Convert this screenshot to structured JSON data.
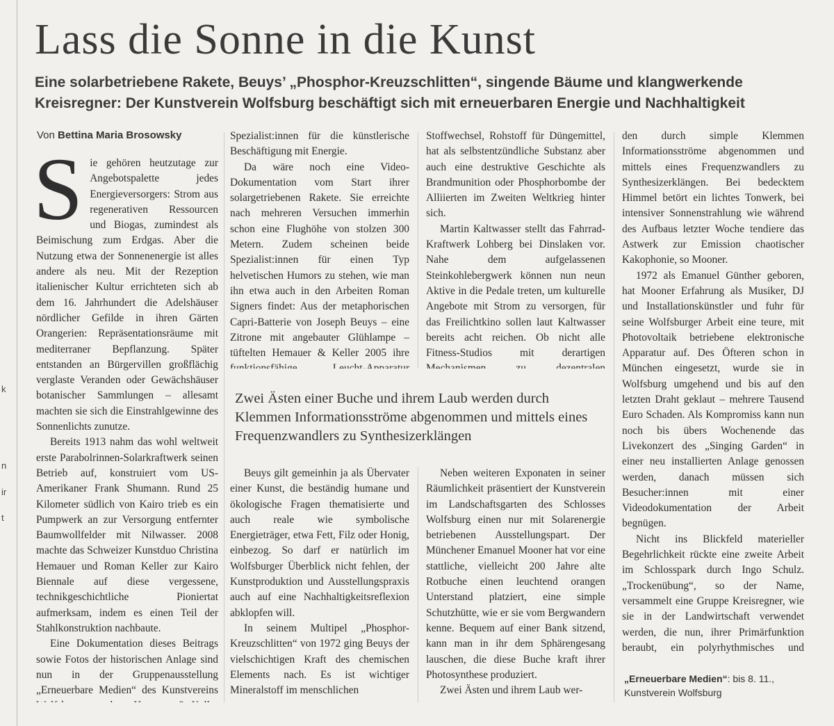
{
  "article": {
    "headline": "Lass die Sonne in die Kunst",
    "subheadline": "Eine solarbetriebene Rakete, Beuys’ „Phosphor-Kreuzschlitten“, singende Bäume und klangwerkende Kreisregner: Der Kunstverein Wolfsburg beschäftigt sich mit erneuerbaren Energie und Nachhaltigkeit",
    "byline_prefix": "Von",
    "byline_author": "Bettina Maria Brosowsky",
    "drop_cap": "S",
    "col1_lead": "ie gehören heutzutage zur Angebotspalette jedes Energieversorgers: Strom aus regenerativen Ressourcen und Biogas, zumindest als Beimischung zum Erdgas. Aber die Nutzung etwa der Sonnenenergie ist alles andere als neu. Mit der Rezeption italienischer Kultur errichteten sich ab dem 16. Jahrhundert die Adelshäuser nördlicher Gefilde in ihren Gärten Orangerien: Repräsentationsräume mit mediterraner Bepflanzung. Später entstanden an Bürgervillen großflächig verglaste Veranden oder Gewächshäuser botanischer Sammlungen – allesamt machten sie sich die Einstrahlgewinne des Sonnenlichts zunutze.",
    "col1_p2": "Bereits 1913 nahm das wohl weltweit erste Parabolrinnen-Solarkraftwerk seinen Betrieb auf, konstruiert vom US-Amerikaner Frank Shumann. Rund 25 Kilometer südlich von Kairo trieb es ein Pumpwerk an zur Versorgung entfernter Baumwollfelder mit Nilwasser. 2008 machte das Schweizer Kunstduo Christina Hemauer und Roman Keller zur Kairo Biennale auf diese vergessene, technikgeschichtliche Pioniertat aufmerksam, indem es einen Teil der Stahlkonstruktion nachbaute.",
    "col1_p3": "Eine Dokumentation dieses Beitrags sowie Fotos der historischen Anlage sind nun in der Gruppenausstellung „Erneuerbare Medien“ des Kunstvereins Wolfsburg zu sehen. Hemauer & Keller haben aber noch mehr im Gepäck, denn sie sind",
    "col2a_p1": "Spezialist:innen für die künstlerische Beschäftigung mit Energie.",
    "col2a_p2": "Da wäre noch eine Video-Dokumentation vom Start ihrer solargetriebenen Rakete. Sie erreichte nach mehreren Versuchen immerhin schon eine Flughöhe von stolzen 300 Metern. Zudem scheinen beide Spezialist:innen für einen Typ helvetischen Humors zu stehen, wie man ihn etwa auch in den Arbeiten Roman Signers findet: Aus der metaphorischen Capri-Batterie von Joseph Beuys – eine Zitrone mit angebauter Glühlampe – tüftelten Hemauer & Keller 2005 ihre funktionsfähige Leucht-Apparatur „Come On Beuys Shine“.",
    "col3a_p1": "Stoffwechsel, Rohstoff für Düngemittel, hat als selbstentzündliche Substanz aber auch eine destruktive Geschichte als Brandmunition oder Phosphorbombe der Alliierten im Zweiten Weltkrieg hinter sich.",
    "col3a_p2": "Martin Kaltwasser stellt das Fahrrad-Kraftwerk Lohberg bei Dinslaken vor. Nahe dem aufgelassenen Steinkohlebergwerk können nun neun Aktive in die Pedale treten, um kulturelle Angebote mit Strom zu versorgen, für das Freilichtkino sollen laut Kaltwasser bereits acht reichen. Ob nicht alle Fitness-Studios mit derartigen Mechanismen zu dezentralen Kleinkraftwerken werden könnten, gibt Kaltwasser noch zu denken.",
    "pull_quote": "Zwei Ästen einer Buche und ihrem Laub werden durch Klemmen Informationsströme abgenommen und mittels eines Frequenzwandlers zu Synthesizerklängen",
    "col2b_p1": "Beuys gilt gemeinhin ja als Übervater einer Kunst, die beständig humane und ökologische Fragen thematisierte und auch reale wie symbolische Energieträger, etwa Fett, Filz oder Honig, einbezog. So darf er natürlich im Wolfsburger Überblick nicht fehlen, der Kunstproduktion und Ausstellungspraxis auch auf eine Nachhaltigkeitsreflexion abklopfen will.",
    "col2b_p2": "In seinem Multipel „Phosphor-Kreuzschlitten“ von 1972 ging Beuys der vielschichtigen Kraft des chemischen Elements nach. Es ist wichtiger Mineralstoff im menschlichen",
    "col3b_p1": "Neben weiteren Exponaten in seiner Räumlichkeit präsentiert der Kunstverein im Landschaftsgarten des Schlosses Wolfsburg einen nur mit Solarenergie betriebenen Ausstellungspart. Der Münchener Emanuel Mooner hat vor eine stattliche, vielleicht 200 Jahre alte Rotbuche einen leuchtend orangen Unterstand platziert, eine simple Schutzhütte, wie er sie vom Bergwandern kenne. Bequem auf einer Bank sitzend, kann man in ihr dem Sphärengesang lauschen, die diese Buche kraft ihrer Photosynthese produziert.",
    "col3b_p2": "Zwei Ästen und ihrem Laub wer-",
    "col4_p1": "den durch simple Klemmen Informationsströme abgenommen und mittels eines Frequenzwandlers zu Synthesizerklängen. Bei bedecktem Himmel betört ein lichtes Tonwerk, bei intensiver Sonnenstrahlung wie während des Aufbaus letzter Woche tendiere das Astwerk zur Emission chaotischer Kakophonie, so Mooner.",
    "col4_p2": "1972 als Emanuel Günther geboren, hat Mooner Erfahrung als Musiker, DJ und Installationskünstler und fuhr für seine Wolfsburger Arbeit eine teure, mit Photovoltaik betriebene elektronische Apparatur auf. Des Öfteren schon in München eingesetzt, wurde sie in Wolfsburg umgehend und bis auf den letzten Draht geklaut – mehrere Tausend Euro Schaden. Als Kompromiss kann nun noch bis übers Wochenende das Livekonzert des „Singing Garden“ in einer neu installierten Anlage genossen werden, danach müssen sich Besucher:innen mit einer Videodokumentation der Arbeit begnügen.",
    "col4_p3": "Nicht ins Blickfeld materieller Begehrlichkeit rückte eine zweite Arbeit im Schlosspark durch Ingo Schulz. „Trockenübung“, so der Name, versammelt eine Gruppe Kreisregner, wie sie in der Landwirtschaft verwendet werden, die nun, ihrer Primärfunktion beraubt, ein polyrhythmisches und mehrstimmiges Klangwerk zum Besten geben. Eine feine Kunst, die mit minimalistischem Auftritt und zarter Ironie unser problematisches Verhältnis zu einer vom Menschen überformten Natur anspricht.",
    "info_title": "„Erneuerbare Medien“",
    "info_rest": ": bis 8. 11.,",
    "info_place": "Kunstverein Wolfsburg"
  },
  "margin_letters": [
    "k",
    "n",
    "ir",
    "t"
  ]
}
